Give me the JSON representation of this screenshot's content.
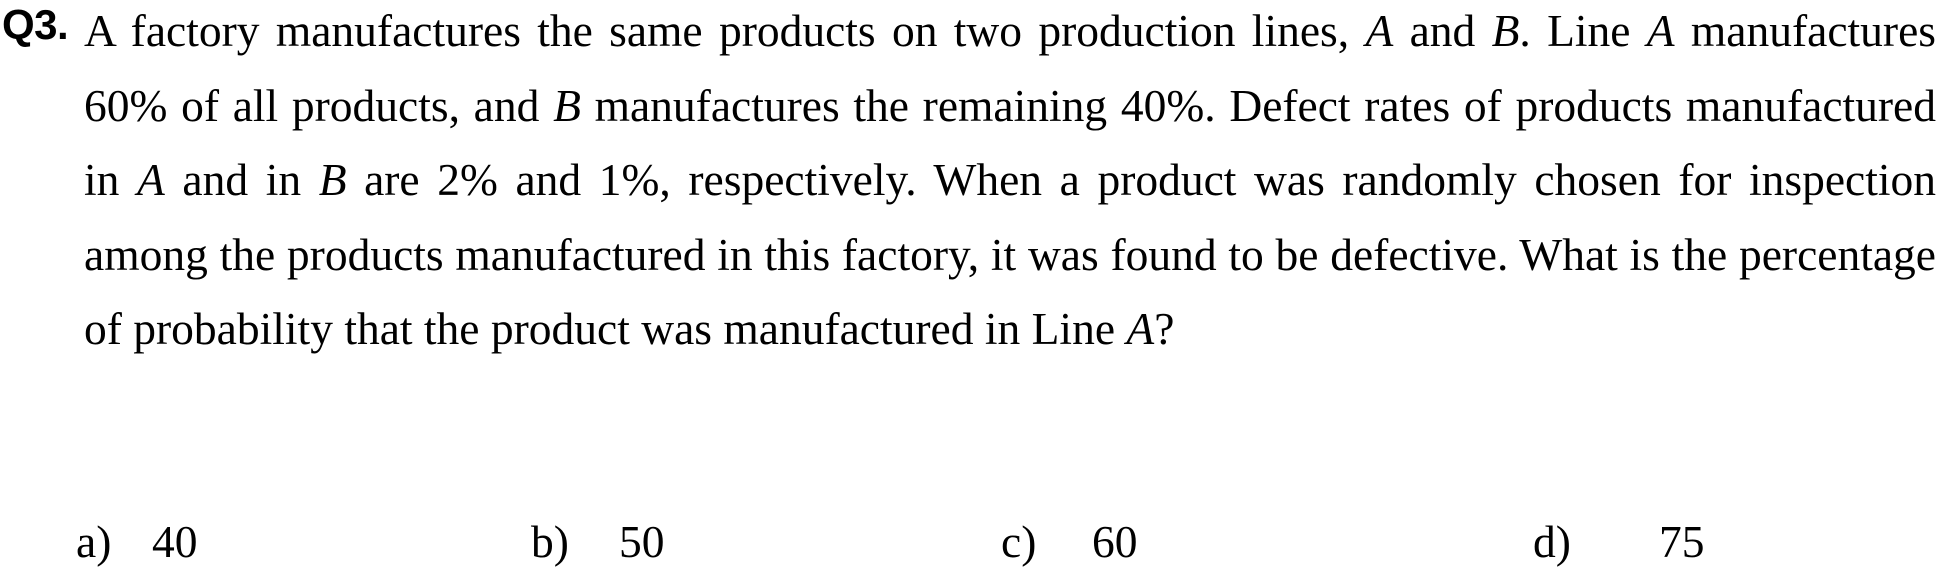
{
  "question": {
    "number": "Q3.",
    "segments": [
      {
        "t": "A factory manufactures the same products on two production lines, "
      },
      {
        "t": "A",
        "i": true
      },
      {
        "t": " and "
      },
      {
        "t": "B",
        "i": true
      },
      {
        "t": ". Line "
      },
      {
        "t": "A",
        "i": true
      },
      {
        "t": " manufactures 60% of all products, and "
      },
      {
        "t": "B",
        "i": true
      },
      {
        "t": " manufactures the remaining 40%. Defect rates of products manufactured in "
      },
      {
        "t": "A",
        "i": true
      },
      {
        "t": " and in "
      },
      {
        "t": "B",
        "i": true
      },
      {
        "t": " are 2% and 1%, respectively. When a product was randomly chosen for inspection among the products manufactured in this factory, it was found to be defective. What is the percentage of probability that the product was manufactured in Line "
      },
      {
        "t": "A",
        "i": true
      },
      {
        "t": "?"
      }
    ]
  },
  "options": [
    {
      "label": "a)",
      "value": "40"
    },
    {
      "label": "b)",
      "value": "50"
    },
    {
      "label": "c)",
      "value": "60"
    },
    {
      "label": "d)",
      "value": "75"
    }
  ]
}
